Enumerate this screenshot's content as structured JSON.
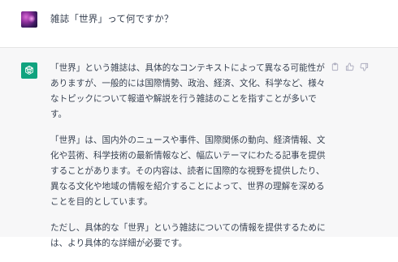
{
  "user": {
    "question": "雑誌「世界」って何ですか？"
  },
  "assistant": {
    "paragraphs": [
      "「世界」という雑誌は、具体的なコンテキストによって異なる可能性がありますが、一般的には国際情勢、政治、経済、文化、科学など、様々なトピックについて報道や解説を行う雑誌のことを指すことが多いです。",
      "「世界」は、国内外のニュースや事件、国際関係の動向、経済情報、文化や芸術、科学技術の最新情報など、幅広いテーマにわたる記事を提供することがあります。その内容は、読者に国際的な視野を提供したり、異なる文化や地域の情報を紹介することによって、世界の理解を深めることを目的としています。",
      "ただし、具体的な「世界」という雑誌についての情報を提供するためには、より具体的な詳細が必要です。"
    ]
  },
  "icons": {
    "user_avatar": "user-avatar-image",
    "assistant_avatar": "openai-logo-icon",
    "copy": "clipboard-icon",
    "like": "thumbs-up-icon",
    "dislike": "thumbs-down-icon"
  },
  "colors": {
    "assistant_bg": "#f7f7f8",
    "logo_bg": "#10a37f",
    "text": "#374151",
    "icon": "#acacbe"
  }
}
